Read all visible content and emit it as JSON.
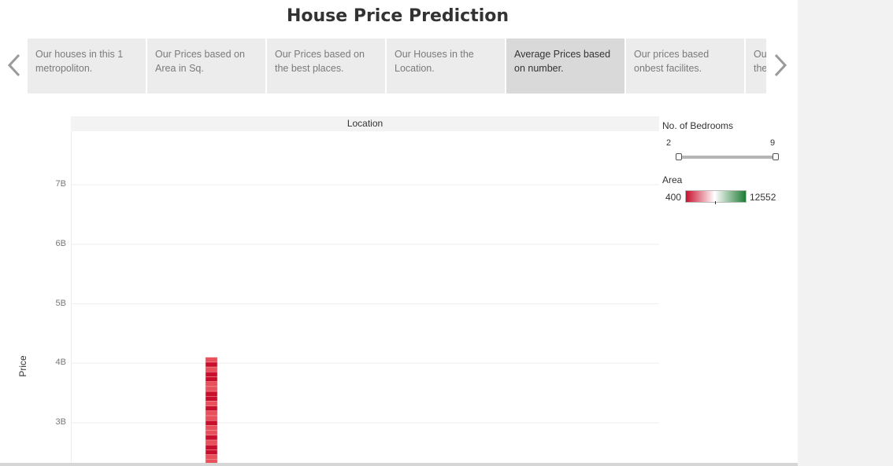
{
  "title": "House Price Prediction",
  "story_tabs": [
    {
      "label": "Our houses in this 1 metropoliton.",
      "active": false
    },
    {
      "label": "Our Prices based on Area in Sq.",
      "active": false
    },
    {
      "label": "Our Prices based on the best places.",
      "active": false
    },
    {
      "label": "Our Houses in the Location.",
      "active": false
    },
    {
      "label": "Average Prices based on number.",
      "active": true
    },
    {
      "label": "Our prices based onbest facilites.",
      "active": false
    },
    {
      "label": "Our prices based on the best places.",
      "active": false
    }
  ],
  "icons": {
    "prev": "chevron-left-icon",
    "next": "chevron-right-icon"
  },
  "colors": {
    "bar_light": "#e8505b",
    "bar_dark": "#c8102e",
    "gradient_low": "#c8102e",
    "gradient_mid": "#ffffff",
    "gradient_high": "#1e7b34"
  },
  "filters": {
    "bedrooms": {
      "title": "No. of Bedrooms",
      "min_label": "2",
      "max_label": "9",
      "range_min": 2,
      "range_max": 9,
      "selected_min": 2,
      "selected_max": 9
    },
    "area": {
      "title": "Area",
      "min_label": "400",
      "max_label": "12552"
    }
  },
  "chart_data": {
    "type": "bar",
    "column_header": "Location",
    "ylabel": "Price",
    "y_ticks": [
      "7B",
      "6B",
      "5B",
      "4B",
      "3B"
    ],
    "y_tick_values": [
      7000000000,
      6000000000,
      5000000000,
      4000000000,
      3000000000
    ],
    "ylim": [
      2300000000,
      7900000000
    ],
    "series": [
      {
        "stack_top": 4100000000,
        "segments": 22
      }
    ],
    "grid": true
  }
}
